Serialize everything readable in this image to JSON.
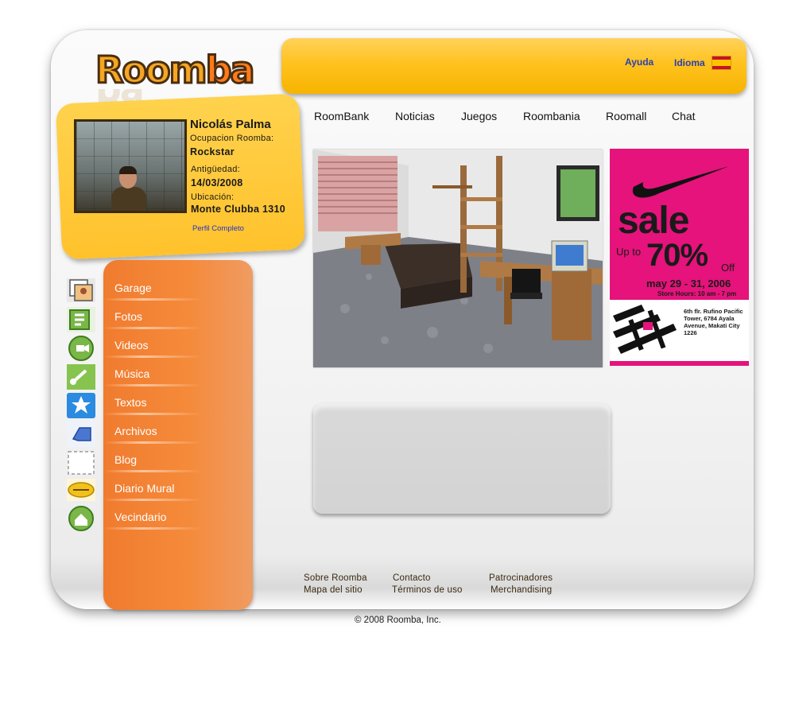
{
  "logo": {
    "part1": "Room",
    "part2": "ba"
  },
  "topbar": {
    "help": "Ayuda",
    "language": "Idioma"
  },
  "nav": [
    "RoomBank",
    "Noticias",
    "Juegos",
    "Roombania",
    "Roomall",
    "Chat"
  ],
  "profile": {
    "name": "Nicolás Palma",
    "occupation_label": "Ocupacion Roomba:",
    "occupation": "Rockstar",
    "seniority_label": "Antigüedad:",
    "seniority": "14/03/2008",
    "location_label": "Ubicación:",
    "location": "Monte Clubba 1310",
    "profile_link": "Perfil Completo"
  },
  "menu": [
    {
      "label": "Garage",
      "icon": "garage-icon"
    },
    {
      "label": "Fotos",
      "icon": "photos-icon"
    },
    {
      "label": "Videos",
      "icon": "videos-icon"
    },
    {
      "label": "Música",
      "icon": "music-icon"
    },
    {
      "label": "Textos",
      "icon": "texts-icon"
    },
    {
      "label": "Archivos",
      "icon": "files-icon"
    },
    {
      "label": "Blog",
      "icon": "blog-icon"
    },
    {
      "label": "Diario Mural",
      "icon": "bulletin-icon"
    },
    {
      "label": "Vecindario",
      "icon": "neighborhood-icon"
    }
  ],
  "ad": {
    "sale": "sale",
    "up_to": "Up to",
    "percent": "70%",
    "off": "Off",
    "dates": "may 29 - 31, 2006",
    "hours": "Store Hours: 10 am - 7 pm",
    "address": "6th flr. Rufino Pacific Tower, 6784 Ayala Avenue, Makati City 1226",
    "brand_color": "#e5137b"
  },
  "footer": {
    "col1": [
      "Sobre Roomba",
      "Mapa del sitio"
    ],
    "col2": [
      "Contacto",
      "Términos de uso"
    ],
    "col3": [
      "Patrocinadores",
      "Merchandising"
    ],
    "copyright": "© 2008 Roomba, Inc."
  },
  "colors": {
    "accent_yellow": "#ffc21f",
    "accent_orange": "#f07b2f",
    "link_blue": "#2a3fb0"
  }
}
